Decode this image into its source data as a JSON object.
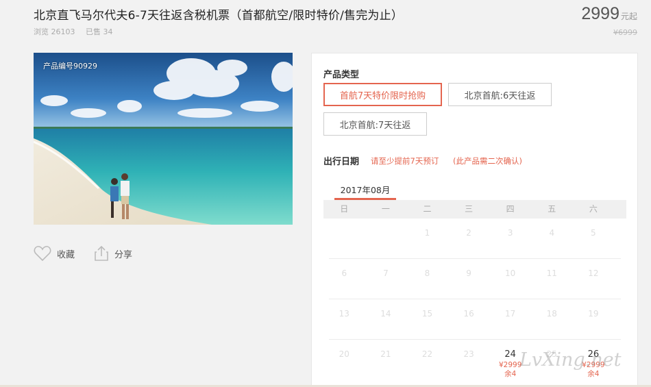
{
  "product": {
    "title": "北京直飞马尔代夫6-7天往返含税机票（首都航空/限时特价/售完为止）",
    "views": "浏览 26103",
    "sold": "已售 34",
    "price": "2999",
    "price_unit": "元起",
    "original_price": "¥6999",
    "code_label": "产品编号90929"
  },
  "actions": {
    "favorite": "收藏",
    "share": "分享"
  },
  "panel": {
    "type_label": "产品类型",
    "options": [
      {
        "label": "首航7天特价限时抢购",
        "selected": true
      },
      {
        "label": "北京首航:6天往返",
        "selected": false
      },
      {
        "label": "北京首航:7天往返",
        "selected": false
      }
    ],
    "date_label": "出行日期",
    "date_hint_1": "请至少提前7天预订",
    "date_hint_2": "(此产品需二次确认)",
    "month": "2017年08月"
  },
  "calendar": {
    "weekdays": [
      "日",
      "一",
      "二",
      "三",
      "四",
      "五",
      "六"
    ],
    "rows": [
      [
        {
          "d": ""
        },
        {
          "d": ""
        },
        {
          "d": "1"
        },
        {
          "d": "2"
        },
        {
          "d": "3"
        },
        {
          "d": "4"
        },
        {
          "d": "5"
        }
      ],
      [
        {
          "d": "6"
        },
        {
          "d": "7"
        },
        {
          "d": "8"
        },
        {
          "d": "9"
        },
        {
          "d": "10"
        },
        {
          "d": "11"
        },
        {
          "d": "12"
        }
      ],
      [
        {
          "d": "13"
        },
        {
          "d": "14"
        },
        {
          "d": "15"
        },
        {
          "d": "16"
        },
        {
          "d": "17"
        },
        {
          "d": "18"
        },
        {
          "d": "19"
        }
      ],
      [
        {
          "d": "20"
        },
        {
          "d": "21"
        },
        {
          "d": "22"
        },
        {
          "d": "23"
        },
        {
          "d": "24",
          "price": "¥2999",
          "remain": "余4"
        },
        {
          "d": "25"
        },
        {
          "d": "26",
          "price": "¥2999",
          "remain": "余4"
        }
      ]
    ]
  },
  "watermark": "LvXing.net",
  "colors": {
    "accent": "#e4644e",
    "background": "#f2f2f2"
  }
}
